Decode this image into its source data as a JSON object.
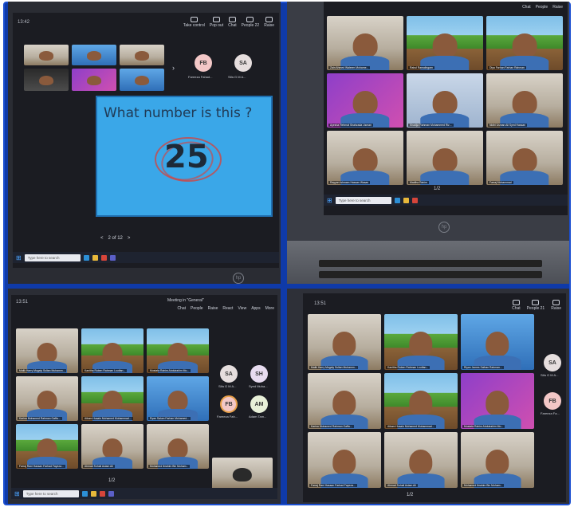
{
  "panel1": {
    "time": "13:42",
    "toolbar": [
      {
        "label": "Take control",
        "icon": "take-control-icon"
      },
      {
        "label": "Pop out",
        "icon": "pop-out-icon"
      },
      {
        "label": "Chat",
        "icon": "chat-icon"
      },
      {
        "label": "People",
        "icon": "people-icon"
      },
      {
        "label": "Raise",
        "icon": "raise-hand-icon"
      }
    ],
    "people_count": "22",
    "avatars": [
      {
        "initials": "FB",
        "label": "Fareeza Fahad...",
        "color": "#f3c7c7"
      },
      {
        "initials": "SA",
        "label": "Sifa G M A...",
        "color": "#e6dede"
      }
    ],
    "slide": {
      "title": "What number is this ?",
      "number": "25"
    },
    "pager": {
      "prev": "<",
      "text": "2 of 12",
      "next": ">"
    },
    "search_placeholder": "Type here to search"
  },
  "panel2": {
    "toolbar": [
      {
        "label": "Chat"
      },
      {
        "label": "People"
      },
      {
        "label": "Raise"
      }
    ],
    "tiles": [
      {
        "name": "Zain Ahmed Waleem Mohame...",
        "bg": "room"
      },
      {
        "name": "Rahul Ramalingam",
        "bg": "minecraft"
      },
      {
        "name": "Diya Farhan Farhan Rahman",
        "bg": "minecraft"
      },
      {
        "name": "Ayesha Rehmat Shahzada Usman",
        "bg": "purple"
      },
      {
        "name": "Khadija Rahman Mohammed Riz...",
        "bg": "sky"
      },
      {
        "name": "Nidhi Usman Ali Syed Hassan",
        "bg": "room"
      },
      {
        "name": "Rayyan Ishmam Hassan Wasan",
        "bg": "room"
      },
      {
        "name": "Madiha Rahim",
        "bg": "room"
      },
      {
        "name": "Farraj Mohammad",
        "bg": "room"
      }
    ],
    "pager": "1/2",
    "search_placeholder": "Type here to search"
  },
  "panel3": {
    "time": "13:51",
    "meeting_title": "Meeting in \"General\"",
    "toolbar": [
      {
        "label": "Chat"
      },
      {
        "label": "People"
      },
      {
        "label": "Raise"
      },
      {
        "label": "React"
      },
      {
        "label": "View"
      },
      {
        "label": "Apps"
      },
      {
        "label": "More"
      }
    ],
    "tiles": [
      {
        "name": "Malik Harry Mugaly Sultan Muhamm...",
        "bg": "room"
      },
      {
        "name": "Kanitha Ruben Rahman Loutfan...",
        "bg": "minecraft"
      },
      {
        "name": "Mustafa Rahim Abdulrahim Mo...",
        "bg": "minecraft"
      },
      {
        "name": "Karina Mohamed Rahman Gaffa...",
        "bg": "room"
      },
      {
        "name": "Aikam Husain Mohamed Muhammad...",
        "bg": "minecraft"
      },
      {
        "name": "Ryan Salum Farhan Mohamed...",
        "bg": "blue"
      },
      {
        "name": "Farraj Rani Hassan Farhad Fayeza...",
        "bg": "minecraft"
      },
      {
        "name": "Ahmad Sohail Aslam Ali",
        "bg": "room"
      },
      {
        "name": "Mohamed Ibrahim Bin Muham...",
        "bg": "room"
      }
    ],
    "avatars": [
      {
        "initials": "SA",
        "label": "Sifa G M A...",
        "color": "#e6dede"
      },
      {
        "initials": "SH",
        "label": "Syed Muha...",
        "color": "#e8dcf0"
      },
      {
        "initials": "FB",
        "label": "Fareeza Fah...",
        "color": "#f3c7c7"
      },
      {
        "initials": "AM",
        "label": "Adam Tam...",
        "color": "#e8f0d8"
      }
    ],
    "pager": "1/2",
    "search_placeholder": "Type here to search"
  },
  "panel4": {
    "time": "13:51",
    "toolbar": [
      {
        "label": "Chat"
      },
      {
        "label": "People"
      },
      {
        "label": "Raise"
      }
    ],
    "people_count": "21",
    "tiles": [
      {
        "name": "Malik Harry Mugaly Sultan Muhamm...",
        "bg": "room"
      },
      {
        "name": "Kanitha Ruben Rahman Loutfan...",
        "bg": "minecraft"
      },
      {
        "name": "Riyan James Salhan Rahman...",
        "bg": "blue"
      },
      {
        "name": "Karina Mohamed Rahman Gaffa...",
        "bg": "room"
      },
      {
        "name": "Aikam Husain Mohamed Muhammad...",
        "bg": "minecraft"
      },
      {
        "name": "Mustafa Rahim Abdulrahim Mo...",
        "bg": "purple"
      },
      {
        "name": "Farraj Rani Hassan Farhad Fayeza...",
        "bg": "room"
      },
      {
        "name": "Ahmad Sohail Aslam Ali",
        "bg": "room"
      },
      {
        "name": "Mohamed Ibrahim Bin Muham...",
        "bg": "room"
      }
    ],
    "avatars": [
      {
        "initials": "SA",
        "label": "Sifa G M A...",
        "color": "#e6dede"
      },
      {
        "initials": "FB",
        "label": "Fareeza Fa...",
        "color": "#f3c7c7"
      }
    ],
    "pager": "1/2"
  }
}
